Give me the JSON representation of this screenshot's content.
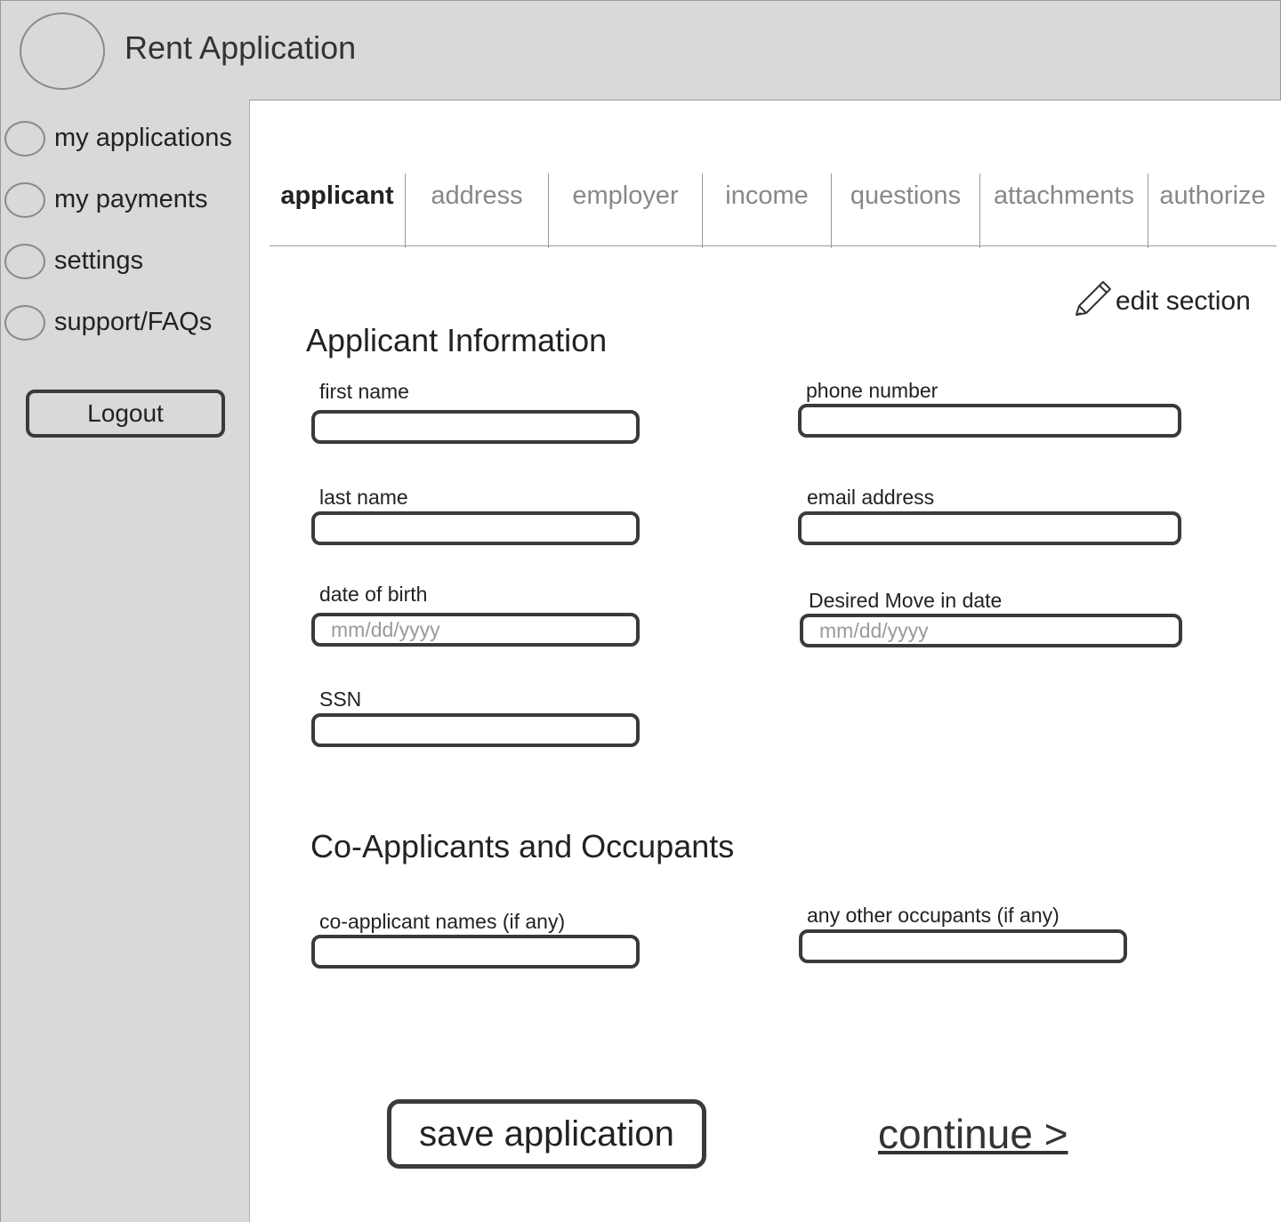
{
  "header": {
    "title": "Rent Application"
  },
  "sidebar": {
    "items": [
      {
        "label": "my applications"
      },
      {
        "label": "my payments"
      },
      {
        "label": "settings"
      },
      {
        "label": "support/FAQs"
      }
    ],
    "logout_label": "Logout"
  },
  "tabs": [
    {
      "label": "applicant",
      "active": true
    },
    {
      "label": "address"
    },
    {
      "label": "employer"
    },
    {
      "label": "income"
    },
    {
      "label": "questions"
    },
    {
      "label": "attachments"
    },
    {
      "label": "authorize"
    }
  ],
  "edit_section": {
    "label": "edit section",
    "icon": "pencil-icon"
  },
  "applicant": {
    "title": "Applicant Information",
    "first_name": {
      "label": "first name",
      "value": ""
    },
    "last_name": {
      "label": "last name",
      "value": ""
    },
    "date_of_birth": {
      "label": "date of birth",
      "placeholder": "mm/dd/yyyy"
    },
    "ssn": {
      "label": "SSN",
      "value": ""
    },
    "phone_number": {
      "label": "phone number",
      "value": ""
    },
    "email_address": {
      "label": "email address",
      "value": ""
    },
    "move_in_date": {
      "label": "Desired Move in date",
      "placeholder": "mm/dd/yyyy"
    }
  },
  "co_applicants": {
    "title": "Co-Applicants and Occupants",
    "names": {
      "label": "co-applicant names (if any)",
      "value": ""
    },
    "occupants": {
      "label": "any other occupants (if any)",
      "value": ""
    }
  },
  "actions": {
    "save_label": "save application",
    "continue_label": "continue >"
  }
}
